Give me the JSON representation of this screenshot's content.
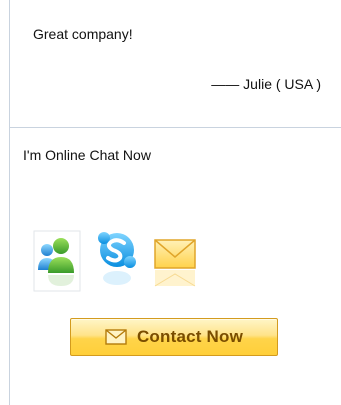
{
  "testimonial": {
    "text": "Great company!",
    "author": "—— Julie ( USA )"
  },
  "chat": {
    "title": "I'm Online Chat Now",
    "icons": [
      "msn-messenger-icon",
      "skype-icon",
      "email-icon"
    ]
  },
  "contact_button": {
    "label": "Contact Now",
    "icon": "envelope-icon"
  },
  "colors": {
    "divider": "#c9d3df",
    "button_top": "#fff6c8",
    "button_bottom": "#ffcf3a",
    "button_border": "#d39b1e",
    "button_text": "#7a4d00"
  }
}
